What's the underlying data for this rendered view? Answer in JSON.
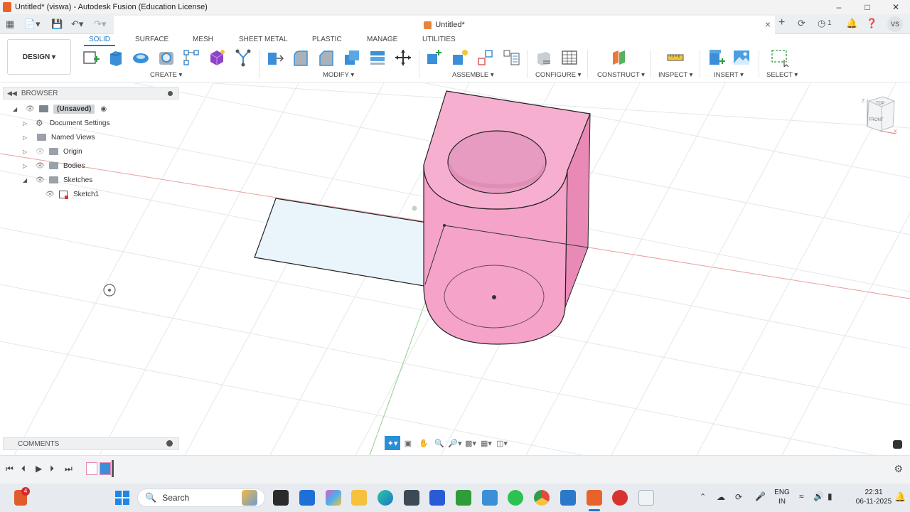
{
  "window": {
    "title": "Untitled* (viswa) - Autodesk Fusion (Education License)",
    "controls": [
      "minimize",
      "maximize",
      "close"
    ]
  },
  "tabbar": {
    "document_tab": "Untitled*",
    "job_count": "1",
    "user_initials": "VS"
  },
  "ribbon": {
    "workspace": "DESIGN",
    "tabs": [
      "SOLID",
      "SURFACE",
      "MESH",
      "SHEET METAL",
      "PLASTIC",
      "MANAGE",
      "UTILITIES"
    ],
    "active_tab": "SOLID",
    "groups": {
      "create": "CREATE",
      "modify": "MODIFY",
      "assemble": "ASSEMBLE",
      "configure": "CONFIGURE",
      "construct": "CONSTRUCT",
      "inspect": "INSPECT",
      "insert": "INSERT",
      "select": "SELECT"
    }
  },
  "browser": {
    "title": "BROWSER",
    "root": "(Unsaved)",
    "items": [
      {
        "label": "Document Settings"
      },
      {
        "label": "Named Views"
      },
      {
        "label": "Origin"
      },
      {
        "label": "Bodies"
      },
      {
        "label": "Sketches"
      },
      {
        "label": "Sketch1"
      }
    ]
  },
  "viewcube": {
    "top": "TOP",
    "front": "FRONT",
    "axis_z": "Z",
    "axis_x": "X"
  },
  "comments": {
    "label": "COMMENTS"
  },
  "taskbar": {
    "search_label": "Search",
    "notification_badge": "4",
    "language_line1": "ENG",
    "language_line2": "IN",
    "time": "22:31",
    "date": "06-11-2025"
  },
  "colors": {
    "accent": "#1b78c9",
    "body_fill": "#f5a3c8",
    "body_fill_dark": "#e98ab6",
    "sketch_fill": "#eaf4fb",
    "grid_line": "#e4e7ea",
    "axis_red": "#e8a0a0",
    "axis_green": "#8fd18f"
  }
}
